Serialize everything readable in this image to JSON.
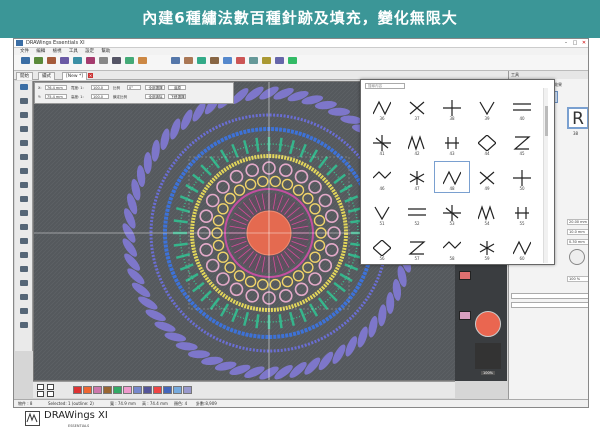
{
  "banner": {
    "text": "內建6種繡法數百種針跡及填充，變化無限大"
  },
  "window": {
    "title": "DRAWings Essentials XI"
  },
  "menu": [
    "文件",
    "編輯",
    "檢視",
    "工具",
    "設定",
    "幫助"
  ],
  "tabs": [
    {
      "label": "開始",
      "active": false
    },
    {
      "label": "繡式",
      "active": false
    },
    {
      "label": "[New *]",
      "active": true
    }
  ],
  "props": {
    "x_label": "X:",
    "x_value": "76.4 mm",
    "y_label": "Y:",
    "y_value": "75.4 mm",
    "w_label": "寬度: 1:",
    "w_value": "100.0",
    "h_label": "高度: 1:",
    "h_value": "100.0",
    "ratio_label": "比例",
    "angle_value": "0°",
    "lock_label": "鎖定比例",
    "btn1": "全部選擇",
    "btn2": "全部清除",
    "btn3": "還原",
    "btn4": "下移選擇"
  },
  "stitch_panel": {
    "search_placeholder": "搜尋內容",
    "items": [
      "36",
      "37",
      "38",
      "39",
      "40",
      "41",
      "42",
      "43",
      "44",
      "45",
      "46",
      "47",
      "48",
      "49",
      "50",
      "51",
      "52",
      "53",
      "54",
      "55",
      "56",
      "57",
      "58",
      "59",
      "60"
    ]
  },
  "right_panel": {
    "header": "工具",
    "tabs": [
      "形狀",
      "填充",
      "效果"
    ],
    "selected_number": "38",
    "field1": "20.00 mm",
    "field2": "10.0 mm",
    "field3": "0.30 mm",
    "field4": "100 %"
  },
  "status": {
    "objects": "物件 : 8",
    "selected": "Selected: 1 (outline: 2)",
    "width": "寬 : 74.9 mm",
    "height": "高 : 74.4 mm",
    "colors": "顏色: 4",
    "stitches": "針數:8,909"
  },
  "footer": {
    "logo_text": "DRAWings XI",
    "logo_sub": "ESSENTIALS"
  },
  "zoom": "100%"
}
